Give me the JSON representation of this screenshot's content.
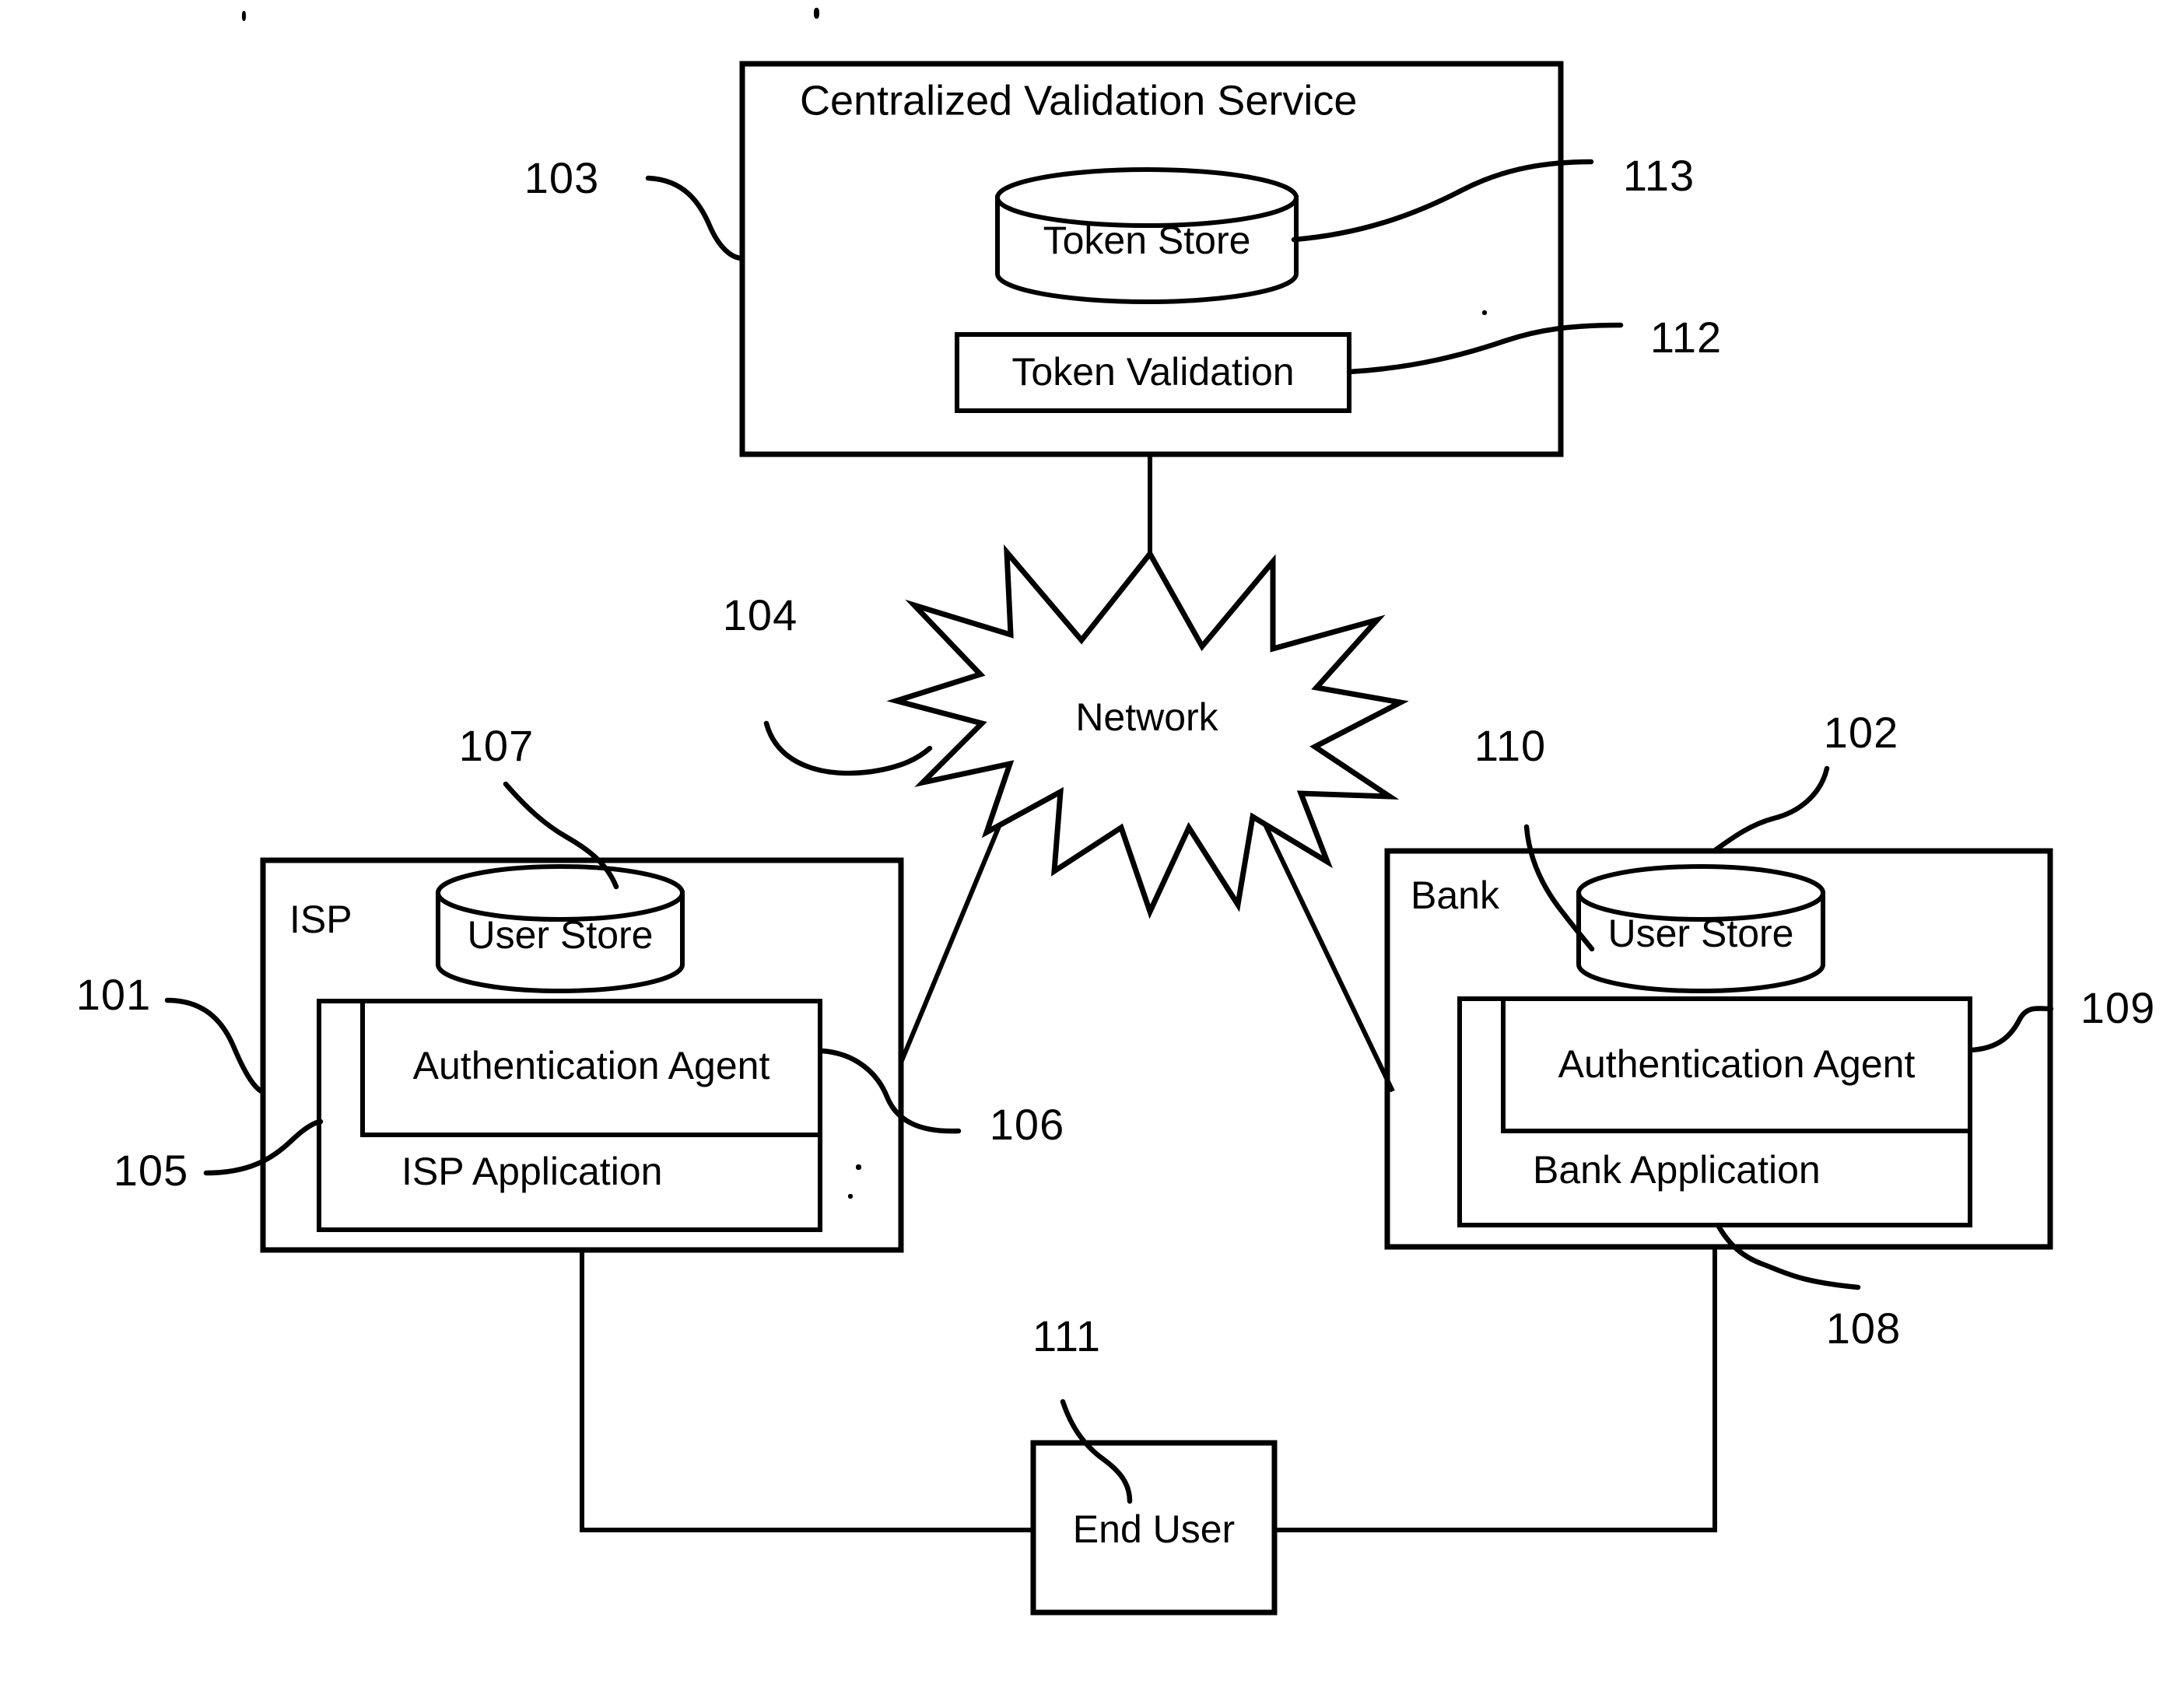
{
  "figure": {
    "type": "patent-block-diagram",
    "background_color": "#ffffff",
    "line_color": "#000000"
  },
  "nodes": {
    "centralized_validation_service": {
      "label": "Centralized Validation Service",
      "ref": "103",
      "children": {
        "token_store": {
          "label": "Token Store",
          "ref": "113",
          "shape": "cylinder"
        },
        "token_validation": {
          "label": "Token Validation",
          "ref": "112",
          "shape": "rectangle"
        }
      }
    },
    "network": {
      "label": "Network",
      "ref": "104",
      "shape": "starburst"
    },
    "isp": {
      "label": "ISP",
      "ref": "101",
      "children": {
        "user_store": {
          "label": "User  Store",
          "ref": "107",
          "shape": "cylinder"
        },
        "authentication_agent": {
          "label": "Authentication Agent",
          "ref": "106",
          "shape": "rectangle"
        },
        "isp_application": {
          "label": "ISP Application",
          "ref": "105",
          "shape": "rectangle"
        }
      }
    },
    "bank": {
      "label": "Bank",
      "ref": "102",
      "children": {
        "user_store": {
          "label": "User  Store",
          "ref": "110",
          "shape": "cylinder"
        },
        "authentication_agent": {
          "label": "Authentication Agent",
          "ref": "109",
          "shape": "rectangle"
        },
        "bank_application": {
          "label": "Bank Application",
          "ref": "108",
          "shape": "rectangle"
        }
      }
    },
    "end_user": {
      "label": "End User",
      "ref": "111",
      "shape": "rectangle"
    }
  },
  "reference_numerals": {
    "n101": "101",
    "n102": "102",
    "n103": "103",
    "n104": "104",
    "n105": "105",
    "n106": "106",
    "n107": "107",
    "n108": "108",
    "n109": "109",
    "n110": "110",
    "n111": "111",
    "n112": "112",
    "n113": "113"
  },
  "connections": [
    {
      "from": "centralized_validation_service",
      "to": "network",
      "style": "straight-line"
    },
    {
      "from": "network",
      "to": "isp_authentication_agent",
      "style": "straight-line"
    },
    {
      "from": "network",
      "to": "bank_authentication_agent",
      "style": "straight-line"
    },
    {
      "from": "isp",
      "to": "end_user",
      "style": "orthogonal-line"
    },
    {
      "from": "bank",
      "to": "end_user",
      "style": "orthogonal-line"
    }
  ]
}
